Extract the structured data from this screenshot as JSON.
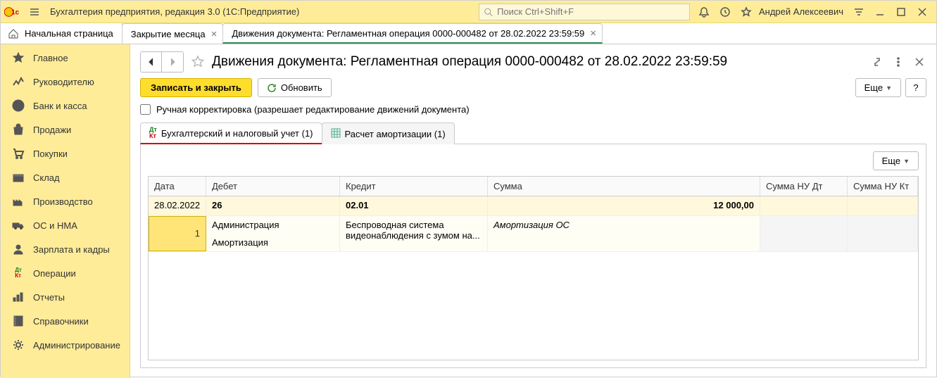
{
  "app": {
    "title": "Бухгалтерия предприятия, редакция 3.0  (1С:Предприятие)",
    "search_placeholder": "Поиск Ctrl+Shift+F",
    "username": "Андрей Алексеевич"
  },
  "nav_tabs": {
    "home": "Начальная страница",
    "tabs": [
      {
        "label": "Закрытие месяца",
        "active": false
      },
      {
        "label": "Движения документа: Регламентная операция 0000-000482 от 28.02.2022 23:59:59",
        "active": true
      }
    ]
  },
  "sidebar": [
    {
      "label": "Главное",
      "icon": "star"
    },
    {
      "label": "Руководителю",
      "icon": "chart"
    },
    {
      "label": "Банк и касса",
      "icon": "ruble"
    },
    {
      "label": "Продажи",
      "icon": "bag"
    },
    {
      "label": "Покупки",
      "icon": "cart"
    },
    {
      "label": "Склад",
      "icon": "box"
    },
    {
      "label": "Производство",
      "icon": "factory"
    },
    {
      "label": "ОС и НМА",
      "icon": "truck"
    },
    {
      "label": "Зарплата и кадры",
      "icon": "person"
    },
    {
      "label": "Операции",
      "icon": "dtkt"
    },
    {
      "label": "Отчеты",
      "icon": "bars"
    },
    {
      "label": "Справочники",
      "icon": "book"
    },
    {
      "label": "Администрирование",
      "icon": "gear"
    }
  ],
  "page": {
    "title": "Движения документа: Регламентная операция 0000-000482 от 28.02.2022 23:59:59",
    "save_close": "Записать и закрыть",
    "refresh": "Обновить",
    "more": "Еще",
    "help": "?",
    "manual_edit_label": "Ручная корректировка (разрешает редактирование движений документа)"
  },
  "inner_tabs": [
    {
      "label": "Бухгалтерский и налоговый учет (1)",
      "kind": "dtkt",
      "active": true
    },
    {
      "label": "Расчет амортизации (1)",
      "kind": "grid",
      "active": false
    }
  ],
  "grid": {
    "headers": {
      "date": "Дата",
      "debet": "Дебет",
      "kredit": "Кредит",
      "sum": "Сумма",
      "nudt": "Сумма НУ Дт",
      "nukt": "Сумма НУ Кт"
    },
    "row1": {
      "date": "28.02.2022",
      "debet": "26",
      "kredit": "02.01",
      "sum": "12 000,00"
    },
    "row2": {
      "num": "1",
      "debet_lines": [
        "Администрация",
        "Амортизация"
      ],
      "kredit_lines": [
        "Беспроводная система видеонаблюдения с зумом на..."
      ],
      "sum_text": "Амортизация ОС"
    }
  }
}
